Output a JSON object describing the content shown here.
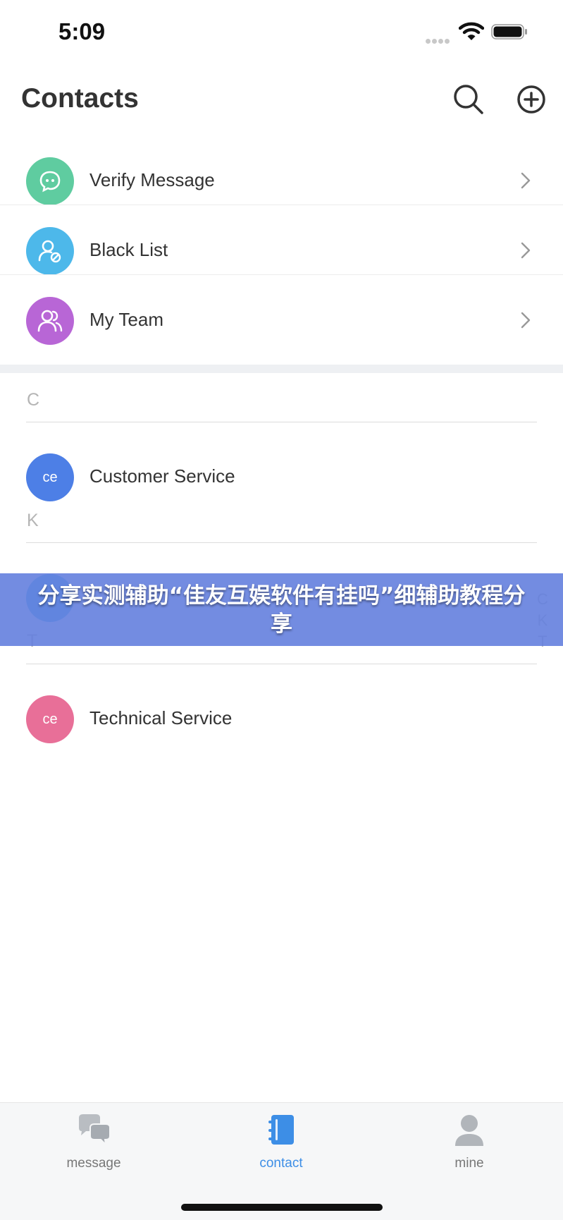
{
  "status_bar": {
    "time": "5:09"
  },
  "header": {
    "title": "Contacts"
  },
  "menu": [
    {
      "label": "Verify Message",
      "icon": "chat-bubble-icon",
      "color": "#5fcca0"
    },
    {
      "label": "Black List",
      "icon": "user-blocked-icon",
      "color": "#4db8ea"
    },
    {
      "label": "My Team",
      "icon": "team-icon",
      "color": "#b866d6"
    }
  ],
  "sections": [
    {
      "letter": "C",
      "contacts": [
        {
          "avatar_text": "ce",
          "name": "Customer Service",
          "color": "#4d7fe6"
        }
      ]
    },
    {
      "letter": "K",
      "contacts": [
        {
          "avatar_text": "",
          "name": "",
          "color": "#4db8ea"
        }
      ]
    },
    {
      "letter": "T",
      "contacts": [
        {
          "avatar_text": "ce",
          "name": "Technical Service",
          "color": "#e86f98"
        }
      ]
    }
  ],
  "index_letters": [
    "C",
    "K",
    "T"
  ],
  "banner": {
    "text": "分享实测辅助“佳友互娱软件有挂吗”细辅助教程分享"
  },
  "tabbar": {
    "tabs": [
      {
        "label": "message",
        "icon": "chat-bubbles-icon"
      },
      {
        "label": "contact",
        "icon": "contact-book-icon",
        "active": true
      },
      {
        "label": "mine",
        "icon": "person-icon"
      }
    ],
    "active_color": "#3d8ee6"
  }
}
